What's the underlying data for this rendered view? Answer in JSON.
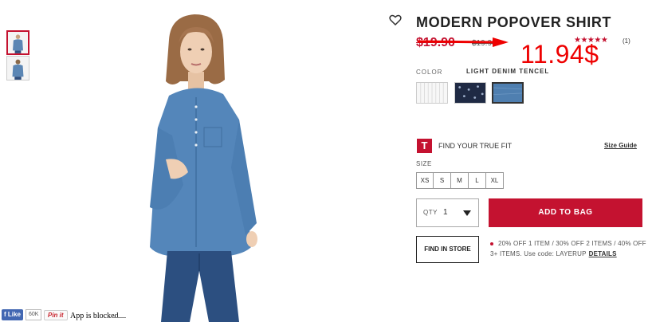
{
  "product": {
    "title": "MODERN POPOVER SHIRT",
    "old_price": "$19.90",
    "old_price_secondary": "$19.90",
    "new_price": "11.94$",
    "rating_stars": "★★★★★",
    "rating_value": 5,
    "review_count": "(1)"
  },
  "color": {
    "label": "COLOR",
    "selected_name": "LIGHT DENIM TENCEL",
    "swatches": [
      "white-stripe",
      "navy-print",
      "light-denim"
    ]
  },
  "fit": {
    "logo": "T",
    "text": "FIND YOUR TRUE FIT",
    "size_guide": "Size Guide"
  },
  "size": {
    "label": "SIZE",
    "options": [
      "XS",
      "S",
      "M",
      "L",
      "XL"
    ]
  },
  "quantity": {
    "label": "QTY",
    "value": "1"
  },
  "actions": {
    "add_to_bag": "ADD TO BAG",
    "find_in_store": "FIND IN STORE"
  },
  "promo": {
    "line1": "20% OFF 1 ITEM / 30% OFF 2 ITEMS / 40% OFF",
    "line2": "3+ ITEMS. Use code: LAYERUP",
    "details_link": "DETAILS"
  },
  "social": {
    "like_label": "Like",
    "like_count": "60K",
    "pin_label": "Pin it",
    "blocked_text": "App is blocked"
  },
  "colors": {
    "brand_red": "#c41230",
    "annotation_red": "#e00000",
    "denim": "#4f7fb0"
  }
}
